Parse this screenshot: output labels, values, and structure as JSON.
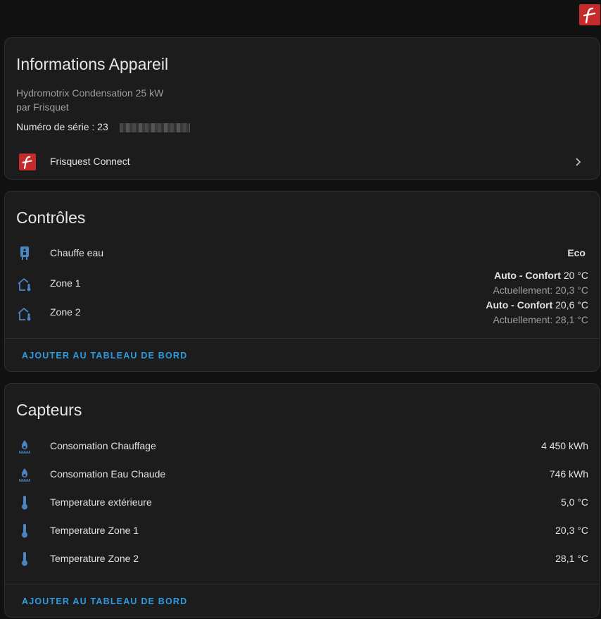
{
  "device_card": {
    "title": "Informations Appareil",
    "model": "Hydromotrix Condensation 25 kW",
    "manufacturer": "par Frisquet",
    "serial_label": "Numéro de série : 23",
    "integration": "Frisquest Connect"
  },
  "controls_card": {
    "title": "Contrôles",
    "items": [
      {
        "label": "Chauffe eau",
        "value": "Eco",
        "icon": "water-heater-icon"
      },
      {
        "label": "Zone 1",
        "mode": "Auto - Confort",
        "setpoint": "20 °C",
        "current": "Actuellement: 20,3 °C",
        "icon": "home-thermometer-icon"
      },
      {
        "label": "Zone 2",
        "mode": "Auto - Confort",
        "setpoint": "20,6 °C",
        "current": "Actuellement: 28,1 °C",
        "icon": "home-thermometer-icon"
      }
    ],
    "action": "AJOUTER AU TABLEAU DE BORD"
  },
  "sensors_card": {
    "title": "Capteurs",
    "items": [
      {
        "label": "Consomation Chauffage",
        "value": "4 450 kWh",
        "icon": "water-boiler-icon"
      },
      {
        "label": "Consomation Eau Chaude",
        "value": "746 kWh",
        "icon": "water-boiler-icon"
      },
      {
        "label": "Temperature extérieure",
        "value": "5,0 °C",
        "icon": "thermometer-icon"
      },
      {
        "label": "Temperature Zone 1",
        "value": "20,3 °C",
        "icon": "thermometer-icon"
      },
      {
        "label": "Temperature Zone 2",
        "value": "28,1 °C",
        "icon": "thermometer-icon"
      }
    ],
    "action": "AJOUTER AU TABLEAU DE BORD"
  },
  "colors": {
    "background": "#111111",
    "card": "#1c1c1c",
    "accent": "#2f9be0",
    "icon": "#4a86c5",
    "brand": "#c62b2b"
  }
}
